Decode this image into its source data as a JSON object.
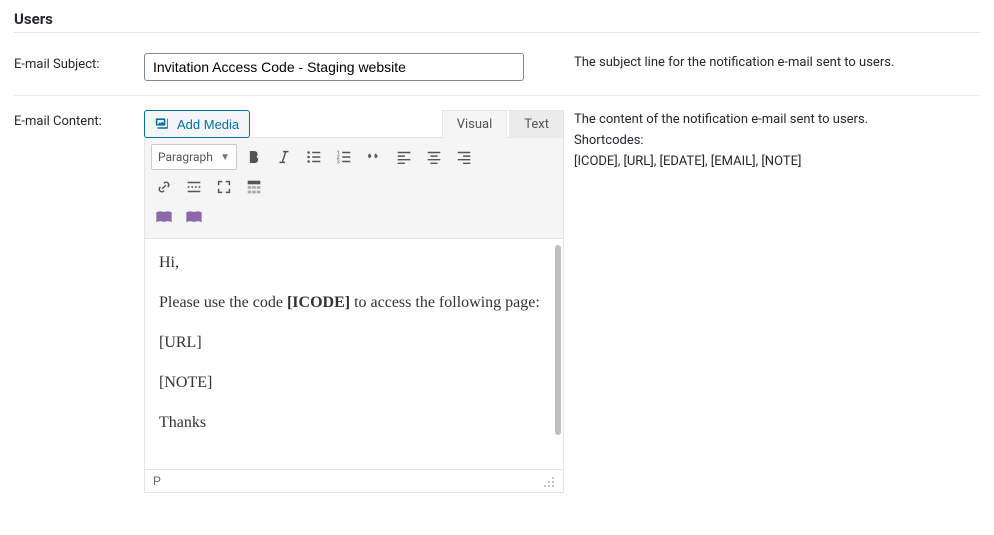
{
  "section_title": "Users",
  "subject": {
    "label": "E-mail Subject:",
    "value": "Invitation Access Code - Staging website",
    "description": "The subject line for the notification e-mail sent to users."
  },
  "content": {
    "label": "E-mail Content:",
    "add_media_label": "Add Media",
    "tabs": {
      "visual": "Visual",
      "text": "Text",
      "active": "visual"
    },
    "format_select": "Paragraph",
    "status_path": "P",
    "body_html": "<p>Hi,</p><p>Please use the code <strong>[ICODE]</strong> to access the following page:</p><p>[URL]</p><p>[NOTE]</p><p>Thanks</p>",
    "description_line1": "The content of the notification e-mail sent to users.",
    "description_line2": "Shortcodes:",
    "description_line3": "[ICODE], [URL], [EDATE], [EMAIL], [NOTE]"
  },
  "toolbar": {
    "row1": [
      "bold",
      "italic",
      "ul",
      "ol",
      "blockquote",
      "align-left",
      "align-center",
      "align-right"
    ],
    "row2": [
      "link",
      "more",
      "fullscreen",
      "kitchen-sink"
    ],
    "row3": [
      "book",
      "book"
    ]
  }
}
